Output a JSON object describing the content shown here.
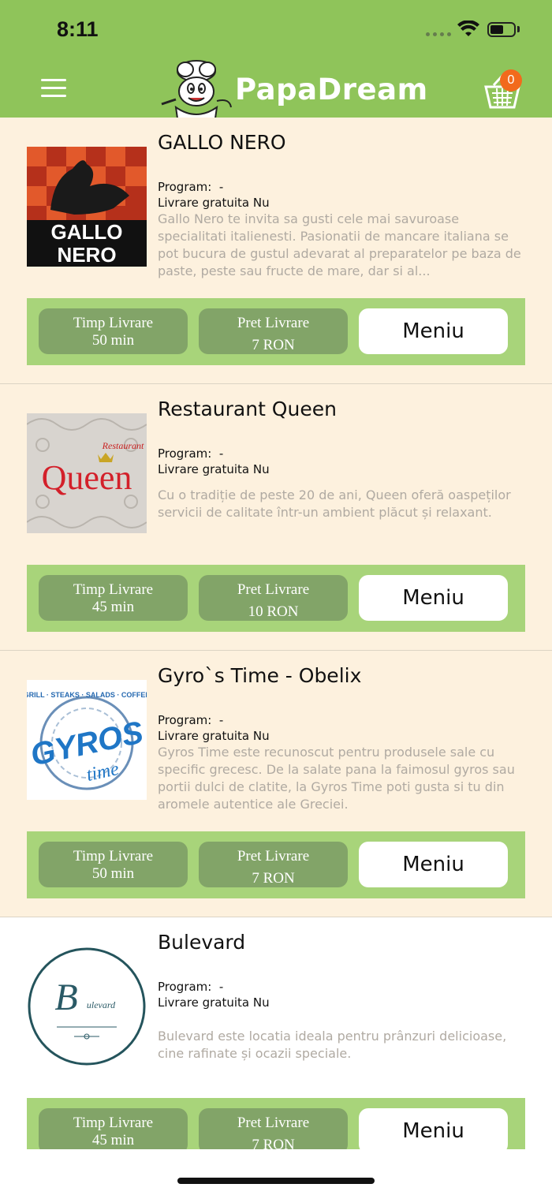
{
  "status_bar": {
    "time": "8:11"
  },
  "header": {
    "brand": "PapaDream",
    "cart_count": "0"
  },
  "labels": {
    "program": "Program:",
    "free_delivery": "Livrare gratuita",
    "delivery_time": "Timp Livrare",
    "delivery_price": "Pret Livrare",
    "menu_button": "Meniu"
  },
  "restaurants": [
    {
      "name": "GALLO NERO",
      "program": "-",
      "free_delivery": "Nu",
      "description": "Gallo Nero te invita sa gusti cele mai savuroase specialitati italienesti. Pasionatii de mancare italiana se pot bucura de gustul adevarat al preparatelor pe baza de paste, peste sau fructe de mare, dar si al...",
      "delivery_time": "50 min",
      "delivery_price": "7 RON",
      "logo_text": [
        "GALLO",
        "NERO"
      ]
    },
    {
      "name": "Restaurant Queen",
      "program": "-",
      "free_delivery": "Nu",
      "description": "Cu o tradiție de peste 20 de ani, Queen oferă oaspeților servicii de calitate într-un ambient plăcut și relaxant.",
      "delivery_time": "45 min",
      "delivery_price": "10 RON",
      "logo_text": [
        "Restaurant",
        "Queen"
      ]
    },
    {
      "name": "Gyro`s Time - Obelix",
      "program": "-",
      "free_delivery": "Nu",
      "description": "Gyros Time este recunoscut pentru produsele sale cu specific grecesc. De la salate pana la faimosul gyros sau portii dulci de clatite, la Gyros Time poti gusta si tu din aromele autentice ale Greciei.",
      "delivery_time": "50 min",
      "delivery_price": "7 RON",
      "logo_text": [
        "GRILL · STEAKS · SALADS · COFFEE",
        "GYROS",
        "time"
      ]
    },
    {
      "name": "Bulevard",
      "program": "-",
      "free_delivery": "Nu",
      "description": "Bulevard este locatia ideala pentru prânzuri delicioase, cine rafinate și ocazii speciale.",
      "delivery_time": "45 min",
      "delivery_price": "7 RON",
      "logo_text": [
        "B",
        "ulevard"
      ]
    }
  ]
}
